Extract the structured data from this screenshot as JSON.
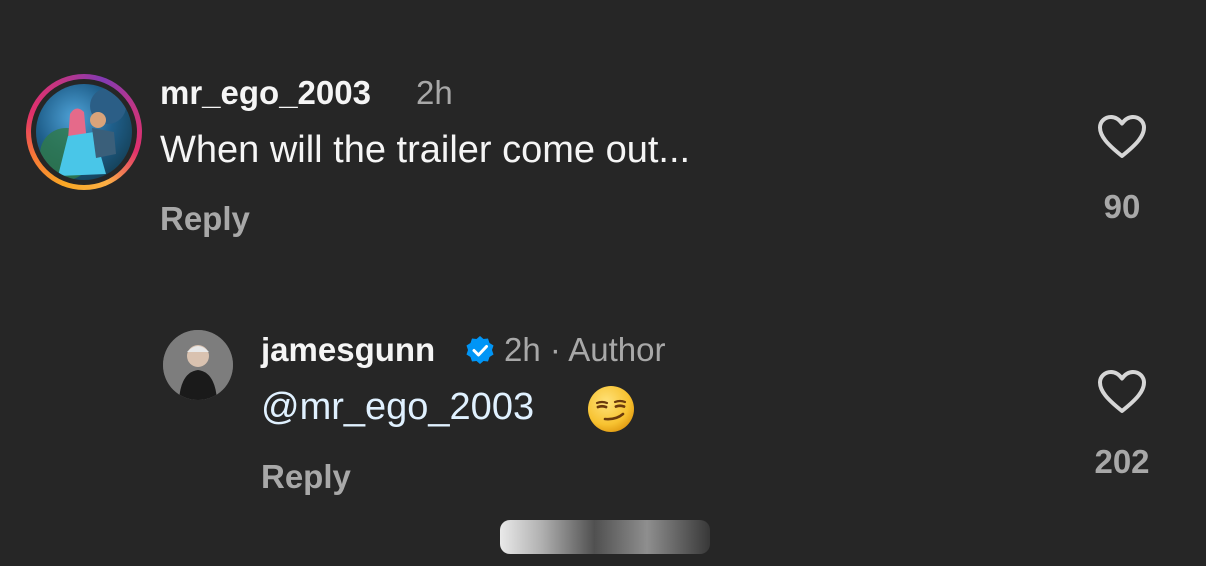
{
  "comments": [
    {
      "username": "mr_ego_2003",
      "time": "2h",
      "text": "When will the trailer come out...",
      "reply_label": "Reply",
      "like_count": "90"
    },
    {
      "username": "jamesgunn",
      "meta": "2h · Author",
      "mention": "@mr_ego_2003",
      "reply_label": "Reply",
      "like_count": "202",
      "verified": true
    }
  ],
  "icons": {
    "like": "heart-outline-icon",
    "verified": "verified-badge-icon",
    "emoji": "smirking-face-emoji"
  },
  "colors": {
    "background": "#262626",
    "primary_text": "#f5f5f5",
    "secondary_text": "#a8a8a8",
    "verified_blue": "#0095f6"
  }
}
